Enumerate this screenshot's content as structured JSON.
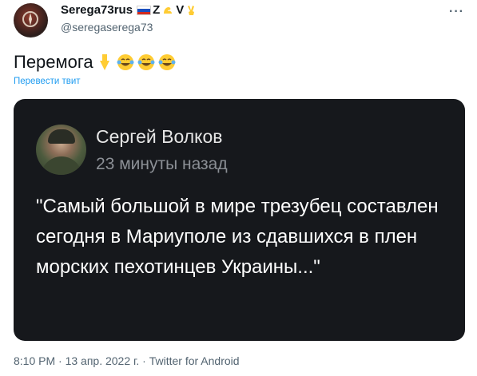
{
  "author": {
    "display_name": "Serega73rus",
    "badge_letters": "Z",
    "badge_letters_2": "V",
    "handle": "@seregaserega73",
    "flag_colors": [
      "#ffffff",
      "#1a4fbf",
      "#d52b1e"
    ]
  },
  "tweet": {
    "text": "Перемога",
    "emojis": [
      "backhand-index-pointing-down",
      "face-with-tears-of-joy",
      "face-with-tears-of-joy",
      "face-with-tears-of-joy"
    ],
    "translate_link": "Перевести твит"
  },
  "embedded_card": {
    "name": "Сергей Волков",
    "time": "23 минуты назад",
    "quote": "\"Самый большой в мире трезубец составлен сегодня в Мариуполе из сдавшихся в плен морских пехотинцев Украины...\""
  },
  "meta": {
    "footer": "8:10 PM · 13 апр. 2022 г. · Twitter for Android"
  },
  "colors": {
    "link": "#1d9bf0",
    "secondary_text": "#536471",
    "card_background": "#16181c"
  }
}
